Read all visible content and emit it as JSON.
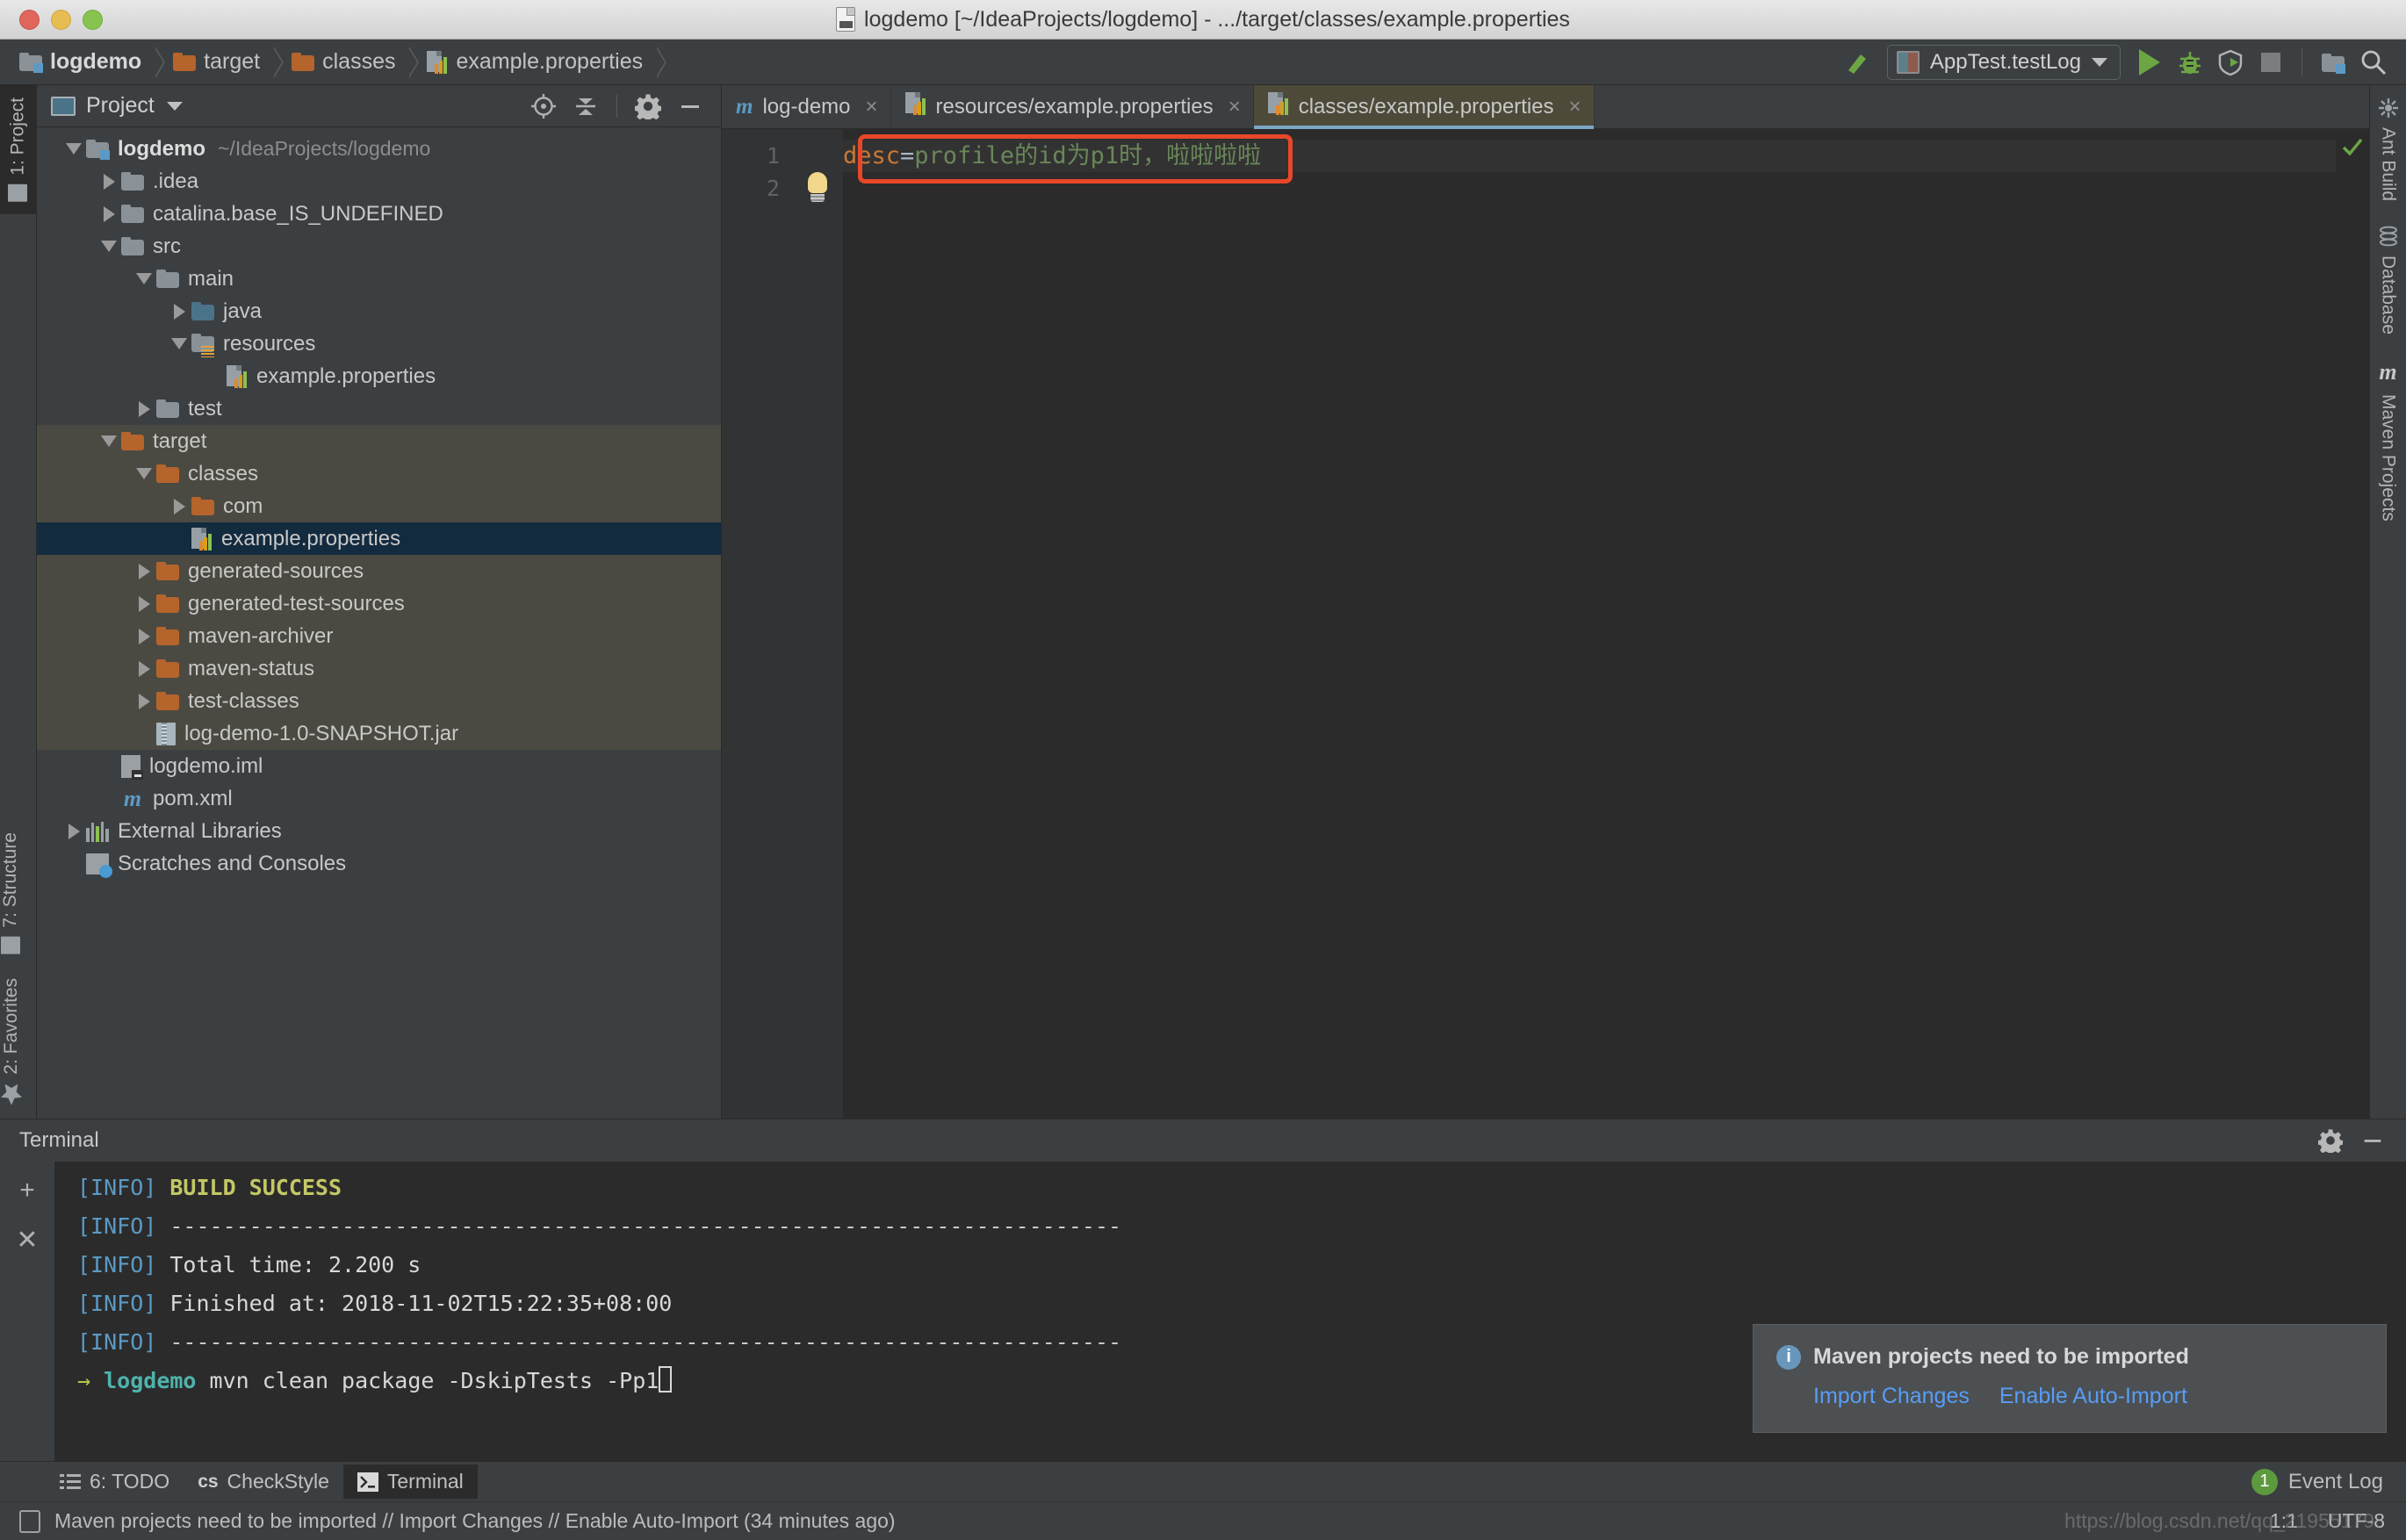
{
  "window": {
    "title": "logdemo [~/IdeaProjects/logdemo] - .../target/classes/example.properties",
    "doc_icon": "java-file-icon"
  },
  "navbar": {
    "breadcrumbs": [
      {
        "label": "logdemo",
        "icon": "module-folder-icon"
      },
      {
        "label": "target",
        "icon": "folder-orange-icon"
      },
      {
        "label": "classes",
        "icon": "folder-orange-icon"
      },
      {
        "label": "example.properties",
        "icon": "properties-file-icon"
      }
    ],
    "run_config": {
      "label": "AppTest.testLog",
      "icon": "run-config-icon"
    },
    "actions": [
      "build-icon",
      "run-icon",
      "debug-icon",
      "run-coverage-icon",
      "stop-icon",
      "project-structure-icon",
      "search-everywhere-icon"
    ]
  },
  "left_rail": [
    {
      "label": "1: Project",
      "icon": "project-folder-icon",
      "selected": true
    }
  ],
  "left_rail_bottom": [
    {
      "label": "7: Structure",
      "icon": "structure-icon"
    },
    {
      "label": "2: Favorites",
      "icon": "star-icon"
    }
  ],
  "right_rail": [
    {
      "label": "Ant Build",
      "icon": "ant-icon"
    },
    {
      "label": "Database",
      "icon": "database-icon"
    },
    {
      "label": "Maven Projects",
      "icon": "maven-m-icon"
    }
  ],
  "project_panel": {
    "title": "Project",
    "window_icon": "project-view-icon",
    "dropdown_icon": "chevron-down-icon",
    "actions": [
      "locate-icon",
      "collapse-all-icon",
      "settings-gear-icon",
      "hide-icon"
    ],
    "tree": [
      {
        "depth": 0,
        "twisty": "down",
        "icon": "module-folder-icon",
        "name": "logdemo",
        "sub": "~/IdeaProjects/logdemo",
        "bold": true,
        "state": "normal"
      },
      {
        "depth": 1,
        "twisty": "right",
        "icon": "folder-icon",
        "name": ".idea",
        "sub": "",
        "state": "normal"
      },
      {
        "depth": 1,
        "twisty": "right",
        "icon": "folder-icon",
        "name": "catalina.base_IS_UNDEFINED",
        "sub": "",
        "state": "normal"
      },
      {
        "depth": 1,
        "twisty": "down",
        "icon": "folder-icon",
        "name": "src",
        "sub": "",
        "state": "normal"
      },
      {
        "depth": 2,
        "twisty": "down",
        "icon": "folder-icon",
        "name": "main",
        "sub": "",
        "state": "normal"
      },
      {
        "depth": 3,
        "twisty": "right",
        "icon": "folder-blue-icon",
        "name": "java",
        "sub": "",
        "state": "normal"
      },
      {
        "depth": 3,
        "twisty": "down",
        "icon": "resources-folder-icon",
        "name": "resources",
        "sub": "",
        "state": "normal"
      },
      {
        "depth": 4,
        "twisty": "none",
        "icon": "properties-file-icon",
        "name": "example.properties",
        "sub": "",
        "state": "normal"
      },
      {
        "depth": 2,
        "twisty": "right",
        "icon": "folder-icon",
        "name": "test",
        "sub": "",
        "state": "normal"
      },
      {
        "depth": 1,
        "twisty": "down",
        "icon": "folder-orange-icon",
        "name": "target",
        "sub": "",
        "state": "highlighted"
      },
      {
        "depth": 2,
        "twisty": "down",
        "icon": "folder-orange-icon",
        "name": "classes",
        "sub": "",
        "state": "highlighted"
      },
      {
        "depth": 3,
        "twisty": "right",
        "icon": "folder-orange-icon",
        "name": "com",
        "sub": "",
        "state": "highlighted"
      },
      {
        "depth": 3,
        "twisty": "none",
        "icon": "properties-file-icon",
        "name": "example.properties",
        "sub": "",
        "state": "selected"
      },
      {
        "depth": 2,
        "twisty": "right",
        "icon": "folder-orange-icon",
        "name": "generated-sources",
        "sub": "",
        "state": "highlighted"
      },
      {
        "depth": 2,
        "twisty": "right",
        "icon": "folder-orange-icon",
        "name": "generated-test-sources",
        "sub": "",
        "state": "highlighted"
      },
      {
        "depth": 2,
        "twisty": "right",
        "icon": "folder-orange-icon",
        "name": "maven-archiver",
        "sub": "",
        "state": "highlighted"
      },
      {
        "depth": 2,
        "twisty": "right",
        "icon": "folder-orange-icon",
        "name": "maven-status",
        "sub": "",
        "state": "highlighted"
      },
      {
        "depth": 2,
        "twisty": "right",
        "icon": "folder-orange-icon",
        "name": "test-classes",
        "sub": "",
        "state": "highlighted"
      },
      {
        "depth": 2,
        "twisty": "none",
        "icon": "jar-file-icon",
        "name": "log-demo-1.0-SNAPSHOT.jar",
        "sub": "",
        "state": "highlighted"
      },
      {
        "depth": 1,
        "twisty": "none",
        "icon": "iml-file-icon",
        "name": "logdemo.iml",
        "sub": "",
        "state": "normal"
      },
      {
        "depth": 1,
        "twisty": "none",
        "icon": "maven-m-icon",
        "name": "pom.xml",
        "sub": "",
        "state": "normal"
      },
      {
        "depth": 0,
        "twisty": "right",
        "icon": "external-libraries-icon",
        "name": "External Libraries",
        "sub": "",
        "state": "normal"
      },
      {
        "depth": 0,
        "twisty": "none",
        "icon": "scratches-icon",
        "name": "Scratches and Consoles",
        "sub": "",
        "state": "normal"
      }
    ]
  },
  "editor": {
    "tabs": [
      {
        "label": "log-demo",
        "icon": "maven-m-icon",
        "active": false,
        "close": "×"
      },
      {
        "label": "resources/example.properties",
        "icon": "properties-file-icon",
        "active": false,
        "close": "×"
      },
      {
        "label": "classes/example.properties",
        "icon": "properties-file-icon",
        "active": true,
        "close": "×"
      }
    ],
    "line_numbers": [
      "1",
      "2"
    ],
    "lines": [
      {
        "key": "desc",
        "op": "=",
        "value": "profile的id为p1时，啦啦啦啦"
      },
      {
        "key": "",
        "op": "",
        "value": ""
      }
    ],
    "gutter_icon": "intention-bulb-icon",
    "inspection_status": "ok-check-icon",
    "annotation_box": {
      "color": "#e8472a",
      "label": "red-highlight-rectangle"
    }
  },
  "terminal": {
    "title": "Terminal",
    "actions": [
      "settings-gear-icon",
      "hide-icon"
    ],
    "side_buttons": [
      "new-session-plus-icon",
      "close-session-x-icon"
    ],
    "lines": [
      {
        "tag": "[INFO]",
        "text": " BUILD SUCCESS",
        "style": "ok"
      },
      {
        "tag": "[INFO]",
        "text": " ------------------------------------------------------------------------",
        "style": "dash"
      },
      {
        "tag": "[INFO]",
        "text": " Total time: 2.200 s",
        "style": "plain"
      },
      {
        "tag": "[INFO]",
        "text": " Finished at: 2018-11-02T15:22:35+08:00",
        "style": "plain"
      },
      {
        "tag": "[INFO]",
        "text": " ------------------------------------------------------------------------",
        "style": "dash"
      }
    ],
    "prompt": {
      "arrow": "→",
      "dir": "logdemo",
      "command": "mvn clean package -DskipTests -Pp1"
    }
  },
  "balloon": {
    "icon": "info-icon",
    "title": "Maven projects need to be imported",
    "links": [
      "Import Changes",
      "Enable Auto-Import"
    ]
  },
  "status_strip": {
    "buttons": [
      {
        "label": "6: TODO",
        "icon": "todo-list-icon",
        "active": false
      },
      {
        "label": "CheckStyle",
        "icon": "checkstyle-icon",
        "active": false
      },
      {
        "label": "Terminal",
        "icon": "terminal-icon",
        "active": true
      }
    ],
    "event_log": {
      "count": "1",
      "label": "Event Log"
    }
  },
  "status_bar": {
    "message": "Maven projects need to be imported // Import Changes // Enable Auto-Import (34 minutes ago)",
    "message_icon": "notification-icon",
    "caret_position": "1:1",
    "encoding": "UTF-8",
    "watermark": "https://blog.csdn.net/qq_21955179"
  },
  "colors": {
    "accent_blue": "#589df6",
    "selection": "#132b3f",
    "highlight": "#4b4a42",
    "annotation_red": "#e8472a",
    "terminal_bg": "#2b2b2b",
    "panel_bg": "#3c3f41"
  }
}
